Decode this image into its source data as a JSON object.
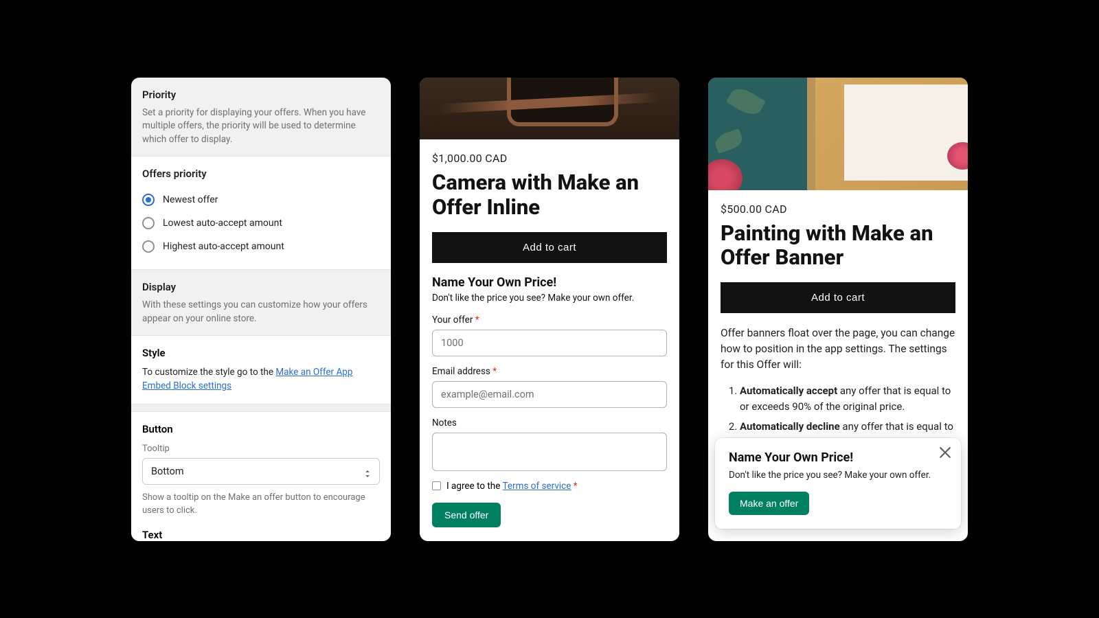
{
  "settings": {
    "priority": {
      "title": "Priority",
      "desc": "Set a priority for displaying your offers. When you have multiple offers, the priority will be used to determine which offer to display."
    },
    "offers_priority": {
      "title": "Offers priority",
      "options": [
        {
          "label": "Newest offer",
          "selected": true
        },
        {
          "label": "Lowest auto-accept amount",
          "selected": false
        },
        {
          "label": "Highest auto-accept amount",
          "selected": false
        }
      ]
    },
    "display": {
      "title": "Display",
      "desc": "With these settings you can customize how your offers appear on your online store."
    },
    "style": {
      "title": "Style",
      "pre_link": "To customize the style go to the ",
      "link_text": "Make an Offer App Embed Block settings"
    },
    "button": {
      "title": "Button",
      "tooltip_label": "Tooltip",
      "tooltip_value": "Bottom",
      "tooltip_help": "Show a tooltip on the Make an offer button to encourage users to click."
    },
    "text": {
      "title": "Text"
    }
  },
  "product_inline": {
    "price": "$1,000.00 CAD",
    "title": "Camera with Make an Offer Inline",
    "add_cart": "Add to cart",
    "offer_hdr": "Name Your Own Price!",
    "offer_sub": "Don't like the price you see? Make your own offer.",
    "your_offer_label": "Your offer ",
    "your_offer_value": "1000",
    "email_label": "Email address ",
    "email_placeholder": "example@email.com",
    "notes_label": "Notes",
    "agree_pre": "I agree to the ",
    "tos_text": "Terms of service",
    "send_label": "Send offer"
  },
  "product_banner": {
    "price": "$500.00 CAD",
    "title": "Painting with Make an Offer Banner",
    "add_cart": "Add to cart",
    "desc": "Offer banners float over the page, you can change how to position in the app settings. The settings for this Offer will:",
    "list": {
      "item1_bold": "Automatically accept",
      "item1_rest": " any offer that is equal to or exceeds 90% of the original price.",
      "item2_bold": "Automatically decline",
      "item2_rest": " any offer that is equal to"
    },
    "float": {
      "title": "Name Your Own Price!",
      "sub": "Don't like the price you see? Make your own offer.",
      "btn": "Make an offer"
    }
  }
}
